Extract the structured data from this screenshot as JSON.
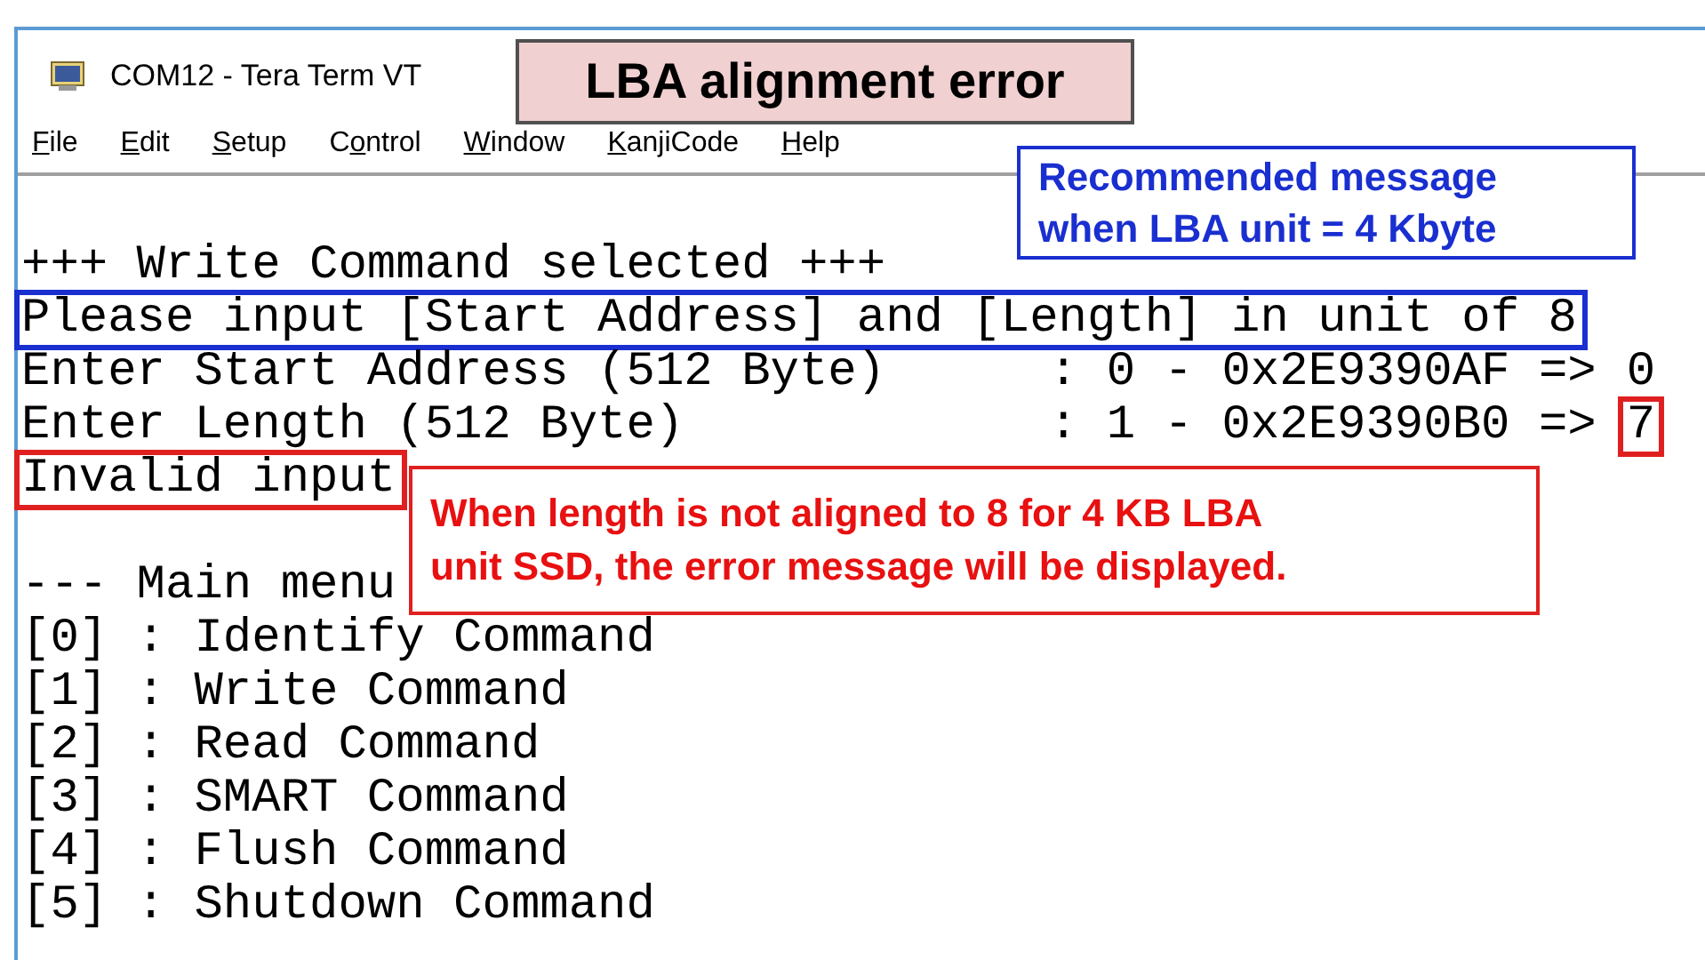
{
  "window": {
    "title": "COM12 - Tera Term VT"
  },
  "menu": [
    {
      "key": "F",
      "rest": "ile"
    },
    {
      "key": "E",
      "rest": "dit"
    },
    {
      "key": "S",
      "rest": "etup"
    },
    {
      "lead": "C",
      "key": "o",
      "rest": "ntrol"
    },
    {
      "key": "W",
      "rest": "indow"
    },
    {
      "key": "K",
      "rest": "anjiCode"
    },
    {
      "key": "H",
      "rest": "elp"
    }
  ],
  "terminal": [
    {
      "kind": "text",
      "text": "+++ Write Command selected +++"
    },
    {
      "kind": "text",
      "text": "Please input [Start Address] and [Length] in unit of 8",
      "color": "#1a2fd0"
    },
    {
      "kind": "prompt",
      "label": "Enter Start Address (512 Byte)",
      "prompt": ": 0 - 0x2E9390AF =>",
      "input": {
        "text": "0"
      }
    },
    {
      "kind": "prompt",
      "label": "Enter Length (512 Byte)",
      "prompt": ": 1 - 0x2E9390B0 =>",
      "input": {
        "text": "7",
        "color": "#e02020"
      }
    },
    {
      "kind": "text",
      "text": "Invalid input",
      "color": "#e02020"
    },
    {
      "kind": "blank"
    },
    {
      "kind": "text",
      "text": "--- Main menu"
    },
    {
      "kind": "text",
      "text": "[0] : Identify Command"
    },
    {
      "kind": "text",
      "text": "[1] : Write Command"
    },
    {
      "kind": "text",
      "text": "[2] : Read Command"
    },
    {
      "kind": "text",
      "text": "[3] : SMART Command"
    },
    {
      "kind": "text",
      "text": "[4] : Flush Command"
    },
    {
      "kind": "text",
      "text": "[5] : Shutdown Command"
    }
  ],
  "callouts": [
    {
      "kind": "title",
      "lines": [
        "LBA alignment error"
      ]
    },
    {
      "kind": "note",
      "lines": [
        "Recommended message",
        "when LBA unit = 4 Kbyte"
      ]
    },
    {
      "kind": "error",
      "lines": [
        "When length is not aligned to 8 for 4 KB LBA",
        "unit SSD, the error message will be displayed."
      ]
    }
  ]
}
